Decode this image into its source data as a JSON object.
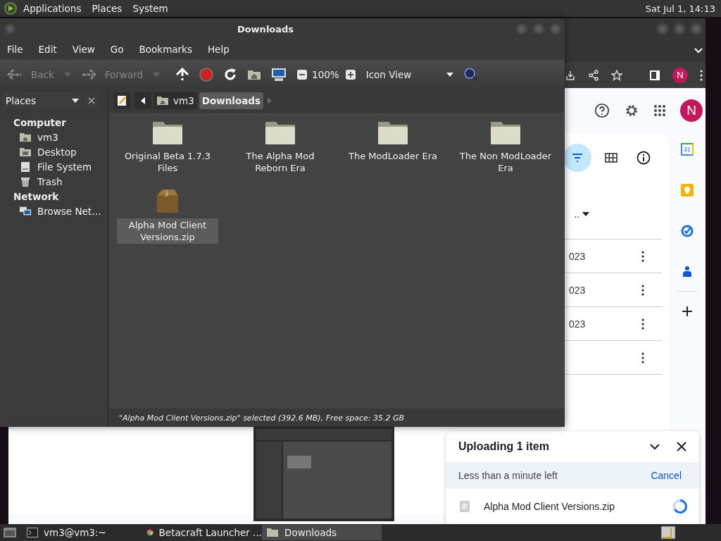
{
  "top_panel": {
    "menus": [
      "Applications",
      "Places",
      "System"
    ],
    "clock": "Sat Jul  1, 14:13"
  },
  "file_manager": {
    "title": "Downloads",
    "menu": [
      "File",
      "Edit",
      "View",
      "Go",
      "Bookmarks",
      "Help"
    ],
    "toolbar": {
      "back": "Back",
      "forward": "Forward",
      "zoom": "100%",
      "view": "Icon View"
    },
    "side_pane": {
      "title": "Places",
      "sections": [
        {
          "title": "Computer",
          "items": [
            {
              "label": "vm3",
              "kind": "home"
            },
            {
              "label": "Desktop",
              "kind": "desktop"
            },
            {
              "label": "File System",
              "kind": "drive"
            },
            {
              "label": "Trash",
              "kind": "trash"
            }
          ]
        },
        {
          "title": "Network",
          "items": [
            {
              "label": "Browse Net…",
              "kind": "network"
            }
          ]
        }
      ]
    },
    "path": [
      {
        "label": "vm3",
        "kind": "home",
        "selected": false
      },
      {
        "label": "Downloads",
        "kind": "plain",
        "selected": true
      }
    ],
    "files": [
      {
        "name": "Original Beta 1.7.3 Files",
        "kind": "folder",
        "selected": false
      },
      {
        "name": "The Alpha Mod Reborn Era",
        "kind": "folder",
        "selected": false
      },
      {
        "name": "The ModLoader Era",
        "kind": "folder",
        "selected": false
      },
      {
        "name": "The Non ModLoader Era",
        "kind": "folder",
        "selected": false
      },
      {
        "name": "Alpha Mod Client Versions.zip",
        "kind": "archive",
        "selected": true
      }
    ],
    "status_bar": "\"Alpha Mod Client Versions.zip\" selected (392.6 MB), Free space: 35.2 GB"
  },
  "browser": {
    "toolbar_avatar": "N",
    "account_avatar": "N",
    "calendar_day": "31",
    "column_header": "..",
    "rows": [
      {
        "date": "023"
      },
      {
        "date": "023"
      },
      {
        "date": "023"
      },
      {}
    ],
    "upload": {
      "title": "Uploading 1 item",
      "eta": "Less than a minute left",
      "cancel": "Cancel",
      "file": "Alpha Mod Client Versions.zip"
    }
  },
  "taskbar": [
    {
      "label": "vm3@vm3:~",
      "kind": "terminal",
      "selected": false
    },
    {
      "label": "Betacraft Launcher ...",
      "kind": "browser",
      "selected": false
    },
    {
      "label": "Downloads",
      "kind": "folder",
      "selected": true
    }
  ]
}
